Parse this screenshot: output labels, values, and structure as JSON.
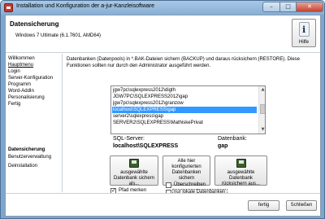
{
  "window": {
    "title": "Installation und Konfiguration der a-jur-Kanzleisoftware",
    "minimize_glyph": "–",
    "maximize_glyph": "□",
    "close_glyph": "✕"
  },
  "header": {
    "title": "Datensicherung",
    "subtitle": "Windows 7 Ultimate (6.1.7601, AMD64)",
    "help_icon_glyph": "i",
    "help_label": "Hilfe"
  },
  "sidebar": {
    "top_items": [
      "Willkommen",
      "Hauptmenu",
      "Login",
      "Server-Konfiguration",
      "Programm",
      "Word-AddIn",
      "Personalisierung",
      "Fertig"
    ],
    "active_item": "Hauptmenu",
    "section_title": "Datensicherung",
    "bottom_items": [
      "Benutzerverwaltung",
      "Deinstallation"
    ]
  },
  "main": {
    "description": "Datenbanken (Datenpools) in *.BAK-Dateien sichern (BACKUP) und daraus rücksichern (RESTORE). Diese Funktionen sollten nur durch den Administrator ausgeführt werden.",
    "database_list": [
      "jgw7pc\\sqlexpress2012\\digth",
      "JGW7PC\\SQLEXPRESS2012\\gap",
      "jgw7pc\\sqlexpress2012\\granzow",
      "localhost\\SQLEXPRESS\\gap",
      "server2\\sqlexpress\\gap",
      "SERVER2\\SQLEXPRESS\\MathiskePrivat"
    ],
    "selected_index": 3,
    "scroll_up_glyph": "▲",
    "scroll_down_glyph": "▼",
    "sql_server_label": "SQL-Server:",
    "sql_server_value": "localhost\\SQLEXPRESS",
    "database_label": "Datenbank:",
    "database_value": "gap",
    "buttons": {
      "backup_selected": [
        "ausgewählte",
        "Datenbank sichern",
        "als..."
      ],
      "backup_all": [
        "Alle hier",
        "konfigurierten",
        "Datenbanken",
        "sichern"
      ],
      "restore_selected": [
        "ausgewählte",
        "Datenbank",
        "rücksichern aus..."
      ]
    },
    "check_glyph": "✓",
    "checkboxes": {
      "pfad_merken": {
        "label": "Pfad merken",
        "checked": true
      },
      "ueberschreiben": {
        "label": "Überschreiben",
        "checked": false
      },
      "nur_lokale": {
        "label": "nur lokale Datenbanken",
        "checked": false
      }
    }
  },
  "footer": {
    "finish_label": "fertig",
    "close_label": "Schließen"
  },
  "colors": {
    "selection": "#3399ff",
    "frame": "#7ea6cc",
    "close_button": "#c7412e"
  }
}
